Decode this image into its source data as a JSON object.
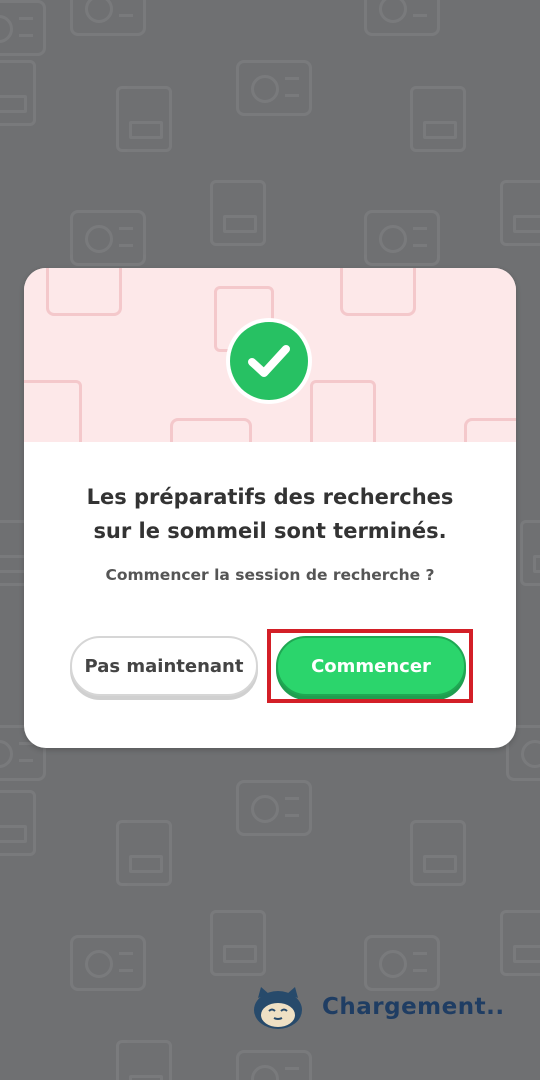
{
  "dialog": {
    "title_line1": "Les préparatifs des recherches",
    "title_line2": "sur le sommeil sont terminés.",
    "subtitle": "Commencer la session de recherche ?",
    "secondary_button": "Pas maintenant",
    "primary_button": "Commencer"
  },
  "loading": {
    "text": "Chargement.."
  },
  "colors": {
    "overlay": "#6f7072",
    "header_bg": "#fde8e9",
    "check_green": "#27c163",
    "primary_button": "#2bd56c",
    "highlight": "#d31f27",
    "loading_text": "#1f3d63"
  },
  "icons": [
    "checkmark-icon",
    "snorlax-icon"
  ]
}
